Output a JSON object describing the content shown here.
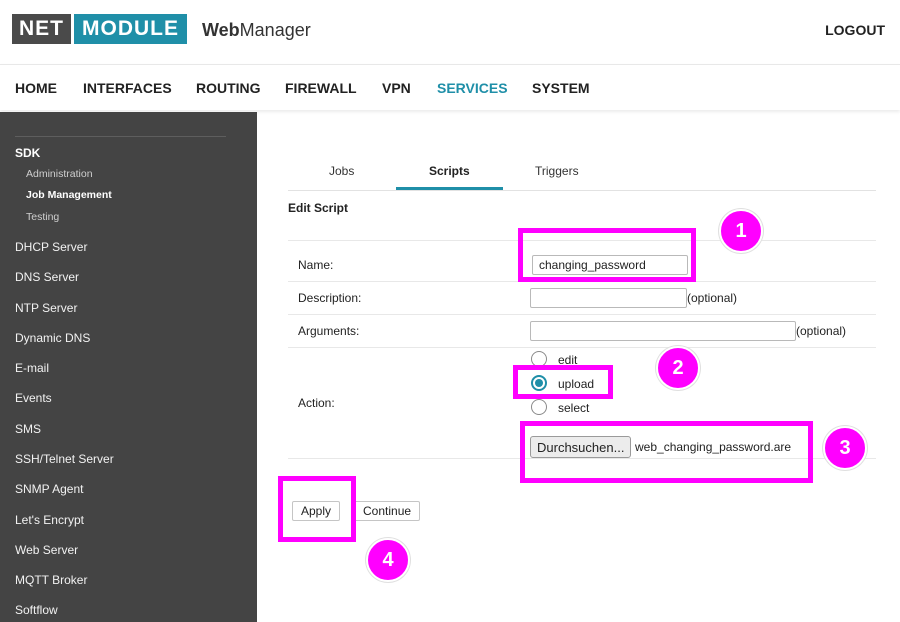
{
  "header": {
    "logo_left": "NET",
    "logo_right": "MODULE",
    "app_name_bold": "Web",
    "app_name_rest": "Manager",
    "logout": "LOGOUT"
  },
  "topnav": [
    "HOME",
    "INTERFACES",
    "ROUTING",
    "FIREWALL",
    "VPN",
    "SERVICES",
    "SYSTEM"
  ],
  "topnav_active": "SERVICES",
  "sidebar": {
    "section": "SDK",
    "subitems": [
      "Administration",
      "Job Management",
      "Testing"
    ],
    "active_subitem": "Job Management",
    "items": [
      "DHCP Server",
      "DNS Server",
      "NTP Server",
      "Dynamic DNS",
      "E-mail",
      "Events",
      "SMS",
      "SSH/Telnet Server",
      "SNMP Agent",
      "Let's Encrypt",
      "Web Server",
      "MQTT Broker",
      "Softflow"
    ]
  },
  "tabs": [
    "Jobs",
    "Scripts",
    "Triggers"
  ],
  "active_tab": "Scripts",
  "form": {
    "title": "Edit Script",
    "name_label": "Name:",
    "name_value": "changing_password",
    "description_label": "Description:",
    "description_value": "",
    "description_hint": "(optional)",
    "arguments_label": "Arguments:",
    "arguments_value": "",
    "arguments_hint": "(optional)",
    "action_label": "Action:",
    "action_options": [
      "edit",
      "upload",
      "select"
    ],
    "action_selected": "upload",
    "browse_button": "Durchsuchen...",
    "file_name": "web_changing_password.are"
  },
  "buttons": {
    "apply": "Apply",
    "continue": "Continue"
  },
  "annotations": [
    "1",
    "2",
    "3",
    "4"
  ],
  "colors": {
    "accent": "#1f8fa8",
    "highlight": "#ff00ff",
    "sidebar_bg": "#444444",
    "logo_dark": "#4a4a4a"
  }
}
